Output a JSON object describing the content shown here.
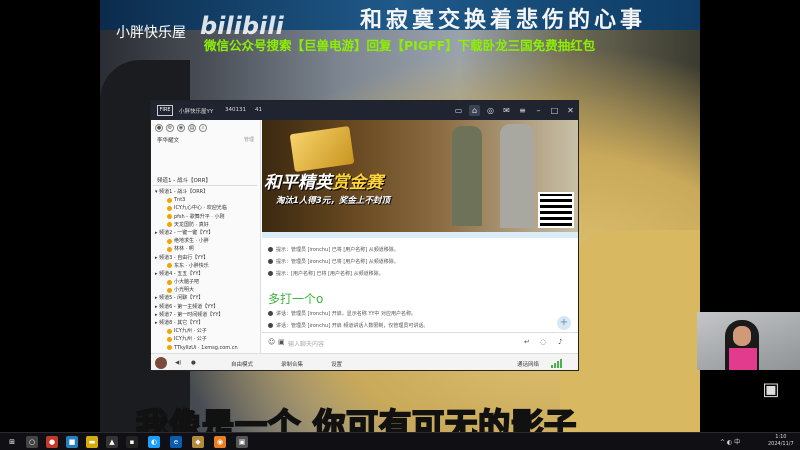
{
  "overlay": {
    "top_lyric": "和寂寞交换着悲伤的心事",
    "channel_name": "小胖快乐屋",
    "bili_logo": "bilibili",
    "promo": "微信公众号搜索【巨兽电游】回复【PIGFF】下载卧龙三国免费抽红包",
    "subtitle": "我像是一个 你可有可无的影子"
  },
  "app": {
    "title_name": "小胖快乐屋YY",
    "title_id": "340131",
    "title_users": "41",
    "logo": "FIRE",
    "left_user": "李华耀文",
    "left_aside": "管理",
    "channel_header": "频道1 - 战斗【ORR】",
    "tree": [
      {
        "type": "ch",
        "text": "▾ 频道1 - 战斗【ORR】"
      },
      {
        "type": "user",
        "text": "Tnt3"
      },
      {
        "type": "user",
        "text": "ICY九心中心 · 欢迎光临"
      },
      {
        "type": "user",
        "text": "pfsh - 歌舞升平 · 小刚"
      },
      {
        "type": "user",
        "text": "天龙国防 · 真好"
      },
      {
        "type": "ch",
        "text": "▸ 频道2 - 一键一键【YY】"
      },
      {
        "type": "user",
        "text": "绝地求生 · 小胖"
      },
      {
        "type": "user",
        "text": "林林 · 啊"
      },
      {
        "type": "ch",
        "text": "▸ 频道3 - 自由行【YY】"
      },
      {
        "type": "user",
        "text": "东东 · 小胖快乐"
      },
      {
        "type": "ch",
        "text": "▸ 频道4 - 五五【YY】"
      },
      {
        "type": "user",
        "text": "小大脑子吧"
      },
      {
        "type": "user",
        "text": "小光明大"
      },
      {
        "type": "ch",
        "text": "▸ 频道5 - 闲聊【YY】"
      },
      {
        "type": "ch",
        "text": "▸ 频道6 - 第一主频道【YY】"
      },
      {
        "type": "ch",
        "text": "▸ 频道7 - 第一时间频道【YY】"
      },
      {
        "type": "ch",
        "text": "▸ 频道8 - 其它【YY】"
      },
      {
        "type": "user",
        "text": "ICY九州 · 公子"
      },
      {
        "type": "user",
        "text": "ICY九州 · 公子"
      },
      {
        "type": "user",
        "text": "TTkyIIzUi · 1xmsg.com.cn"
      }
    ],
    "banner": {
      "headline_a": "和平精英",
      "headline_b": "赏金赛",
      "subline": "淘汰1人得3元，奖金上不封顶"
    },
    "chat": {
      "m1": "提示：管理员 [ironchu] 已将 [用户名称] 从频道移除。",
      "m2": "提示：管理员 [ironchu] 已将 [用户名称] 从频道移除。",
      "m3": "提示：[用户名称] 已将 [用户名称] 从频道移除。",
      "big": "多打一个o",
      "m4": "讲话：管理员 [ironchu] 开启，显示名称 YY中 对应用户名称。",
      "m5": "讲话：管理员 [ironchu] 开启 频道讲话人数限制，仅管理员可讲话。"
    },
    "input_placeholder": "输入聊天内容",
    "status": {
      "mic": "自由模式",
      "record": "录制合集",
      "settings": "设置",
      "net": "通话网络"
    }
  },
  "taskbar": {
    "time": "1:10",
    "date": "2024/11/7",
    "tray_text": "^ ◐ 中"
  }
}
